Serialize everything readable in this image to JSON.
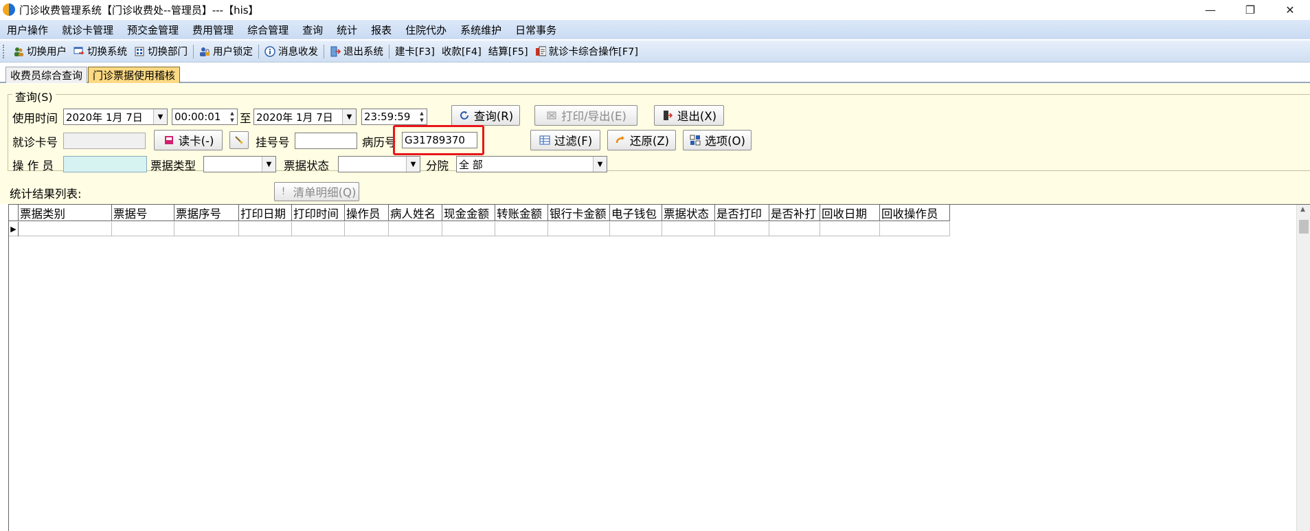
{
  "window": {
    "title": "门诊收费管理系统【门诊收费处--管理员】---【his】",
    "controls": [
      "—",
      "❐",
      "✕"
    ]
  },
  "menu": [
    "用户操作",
    "就诊卡管理",
    "预交金管理",
    "费用管理",
    "综合管理",
    "查询",
    "统计",
    "报表",
    "住院代办",
    "系统维护",
    "日常事务"
  ],
  "toolbar": {
    "switch_user": "切换用户",
    "switch_system": "切换系统",
    "switch_dept": "切换部门",
    "user_lock": "用户锁定",
    "message": "消息收发",
    "exit_system": "退出系统",
    "build_card": "建卡[F3]",
    "collect": "收款[F4]",
    "settle": "结算[F5]",
    "card_ops": "就诊卡综合操作[F7]"
  },
  "tabs": {
    "tab1": "收费员综合查询",
    "tab2": "门诊票据使用稽核"
  },
  "query": {
    "group_title": "查询(S)",
    "time_label": "使用时间",
    "date_from": "2020年 1月 7日",
    "time_from": "00:00:01",
    "to_label": "至",
    "date_to": "2020年 1月 7日",
    "time_to": "23:59:59",
    "card_label": "就诊卡号",
    "card_value": "",
    "read_card": "读卡(-)",
    "reg_label": "挂号号",
    "reg_value": "",
    "record_label": "病历号",
    "record_value": "G31789370",
    "operator_label": "操 作 员",
    "operator_value": "",
    "type_label": "票据类型",
    "type_value": "",
    "status_label": "票据状态",
    "status_value": "",
    "branch_label": "分院",
    "branch_value": "全 部",
    "btn_query": "查询(R)",
    "btn_print": "打印/导出(E)",
    "btn_exit": "退出(X)",
    "btn_filter": "过滤(F)",
    "btn_restore": "还原(Z)",
    "btn_options": "选项(O)"
  },
  "results": {
    "label": "统计结果列表:",
    "clear_btn": "清单明细(Q)"
  },
  "grid": {
    "columns": [
      "票据类别",
      "票据号",
      "票据序号",
      "打印日期",
      "打印时间",
      "操作员",
      "病人姓名",
      "现金金额",
      "转账金额",
      "银行卡金额",
      "电子钱包",
      "票据状态",
      "是否打印",
      "是否补打",
      "回收日期",
      "回收操作员"
    ]
  }
}
